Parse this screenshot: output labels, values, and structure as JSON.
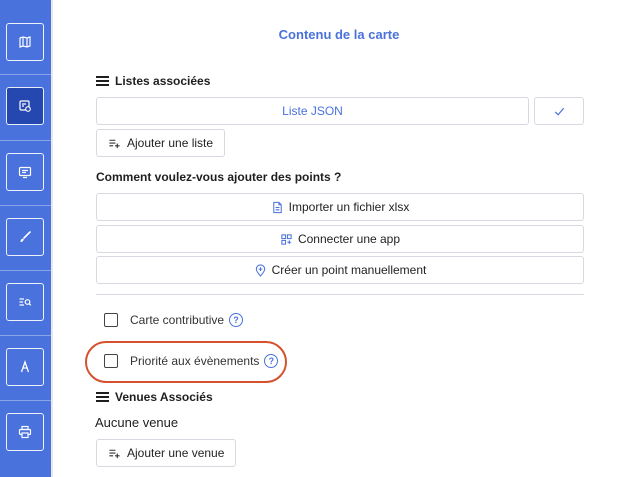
{
  "sidebar": {
    "items": [
      {
        "icon": "map-icon",
        "active": false
      },
      {
        "icon": "card-content-icon",
        "active": true
      },
      {
        "icon": "display-icon",
        "active": false
      },
      {
        "icon": "brush-icon",
        "active": false
      },
      {
        "icon": "search-list-icon",
        "active": false
      },
      {
        "icon": "text-style-icon",
        "active": false
      },
      {
        "icon": "print-icon",
        "active": false
      }
    ],
    "accent": "#4a72dc",
    "active_color": "#2447b0"
  },
  "panel": {
    "title": "Contenu de la carte"
  },
  "lists_section": {
    "heading": "Listes associées",
    "selected_list": "Liste JSON",
    "add_list_label": "Ajouter une liste"
  },
  "points_section": {
    "question": "Comment voulez-vous ajouter des points ?",
    "import_label": "Importer un fichier xlsx",
    "connect_label": "Connecter une app",
    "manual_label": "Créer un point manuellement"
  },
  "options": {
    "contributive_label": "Carte contributive",
    "contributive_checked": false,
    "events_priority_label": "Priorité aux évènements",
    "events_priority_checked": false,
    "help_glyph": "?"
  },
  "venues_section": {
    "heading": "Venues Associés",
    "empty_text": "Aucune venue",
    "add_venue_label": "Ajouter une venue"
  },
  "highlight_color": "#d4532e"
}
